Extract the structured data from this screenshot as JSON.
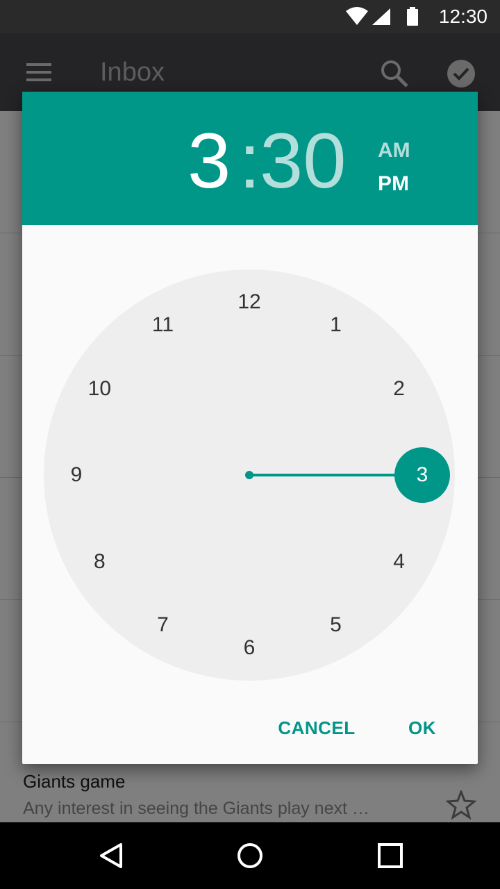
{
  "status_bar": {
    "time": "12:30",
    "icons": [
      "wifi-icon",
      "cell-signal-icon",
      "battery-icon"
    ]
  },
  "app_bar": {
    "title": "Inbox",
    "icons": [
      "menu-icon",
      "search-icon",
      "done-icon"
    ]
  },
  "inbox": {
    "visible_item": {
      "subject": "Giants game",
      "snippet": "Any interest in seeing the Giants play next …"
    }
  },
  "time_picker": {
    "hour": "3",
    "separator": ":",
    "minute": "30",
    "am_label": "AM",
    "pm_label": "PM",
    "selected_period": "PM",
    "selected_hour": "3",
    "dial_numbers": [
      "12",
      "1",
      "2",
      "3",
      "4",
      "5",
      "6",
      "7",
      "8",
      "9",
      "10",
      "11"
    ],
    "cancel_label": "CANCEL",
    "ok_label": "OK"
  },
  "colors": {
    "accent": "#009688",
    "accent_light": "#b2dfdb",
    "dial_background": "#eeeeee",
    "dialog_background": "#fafafa"
  },
  "nav_bar": {
    "icons": [
      "back-icon",
      "home-icon",
      "recents-icon"
    ]
  }
}
